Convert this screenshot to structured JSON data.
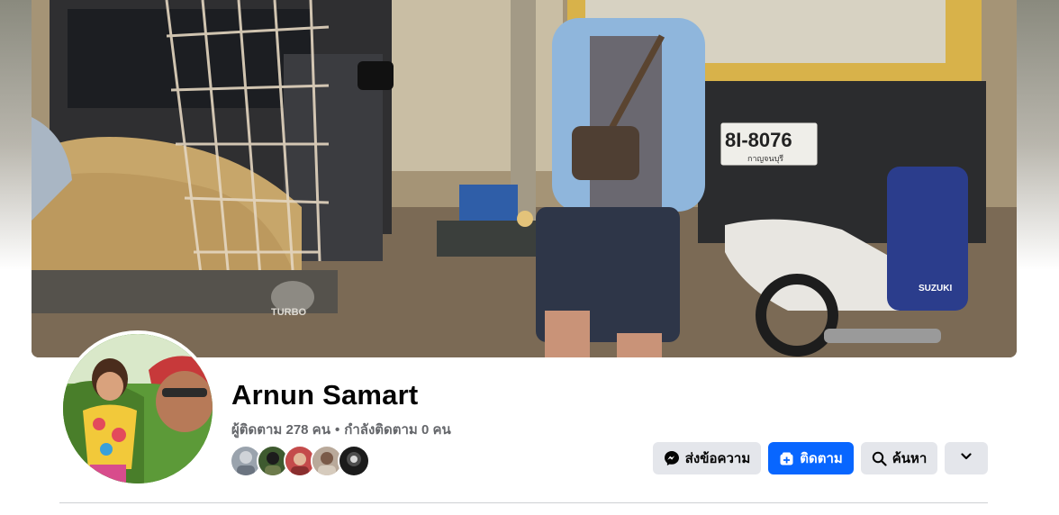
{
  "profile": {
    "name": "Arnun Samart",
    "followers_text": "ผู้ติดตาม 278 คน",
    "separator": "•",
    "following_text": "กำลังติดตาม 0 คน"
  },
  "cover_photo": {
    "plate_number": "8I-8076",
    "plate_province": "กาญจนบุรี",
    "tailgate_text": "TURBO",
    "motorcycle_text": "SUZUKI"
  },
  "friends_preview": [
    {
      "icon": "friend-avatar"
    },
    {
      "icon": "friend-avatar"
    },
    {
      "icon": "friend-avatar"
    },
    {
      "icon": "friend-avatar"
    },
    {
      "icon": "friend-avatar"
    }
  ],
  "actions": {
    "message_label": "ส่งข้อความ",
    "follow_label": "ติดตาม",
    "search_label": "ค้นหา",
    "more_icon": "chevron-down-icon"
  },
  "colors": {
    "primary": "#0866ff",
    "secondary_button": "#e4e6eb",
    "text_primary": "#050505",
    "text_secondary": "#65676b"
  }
}
